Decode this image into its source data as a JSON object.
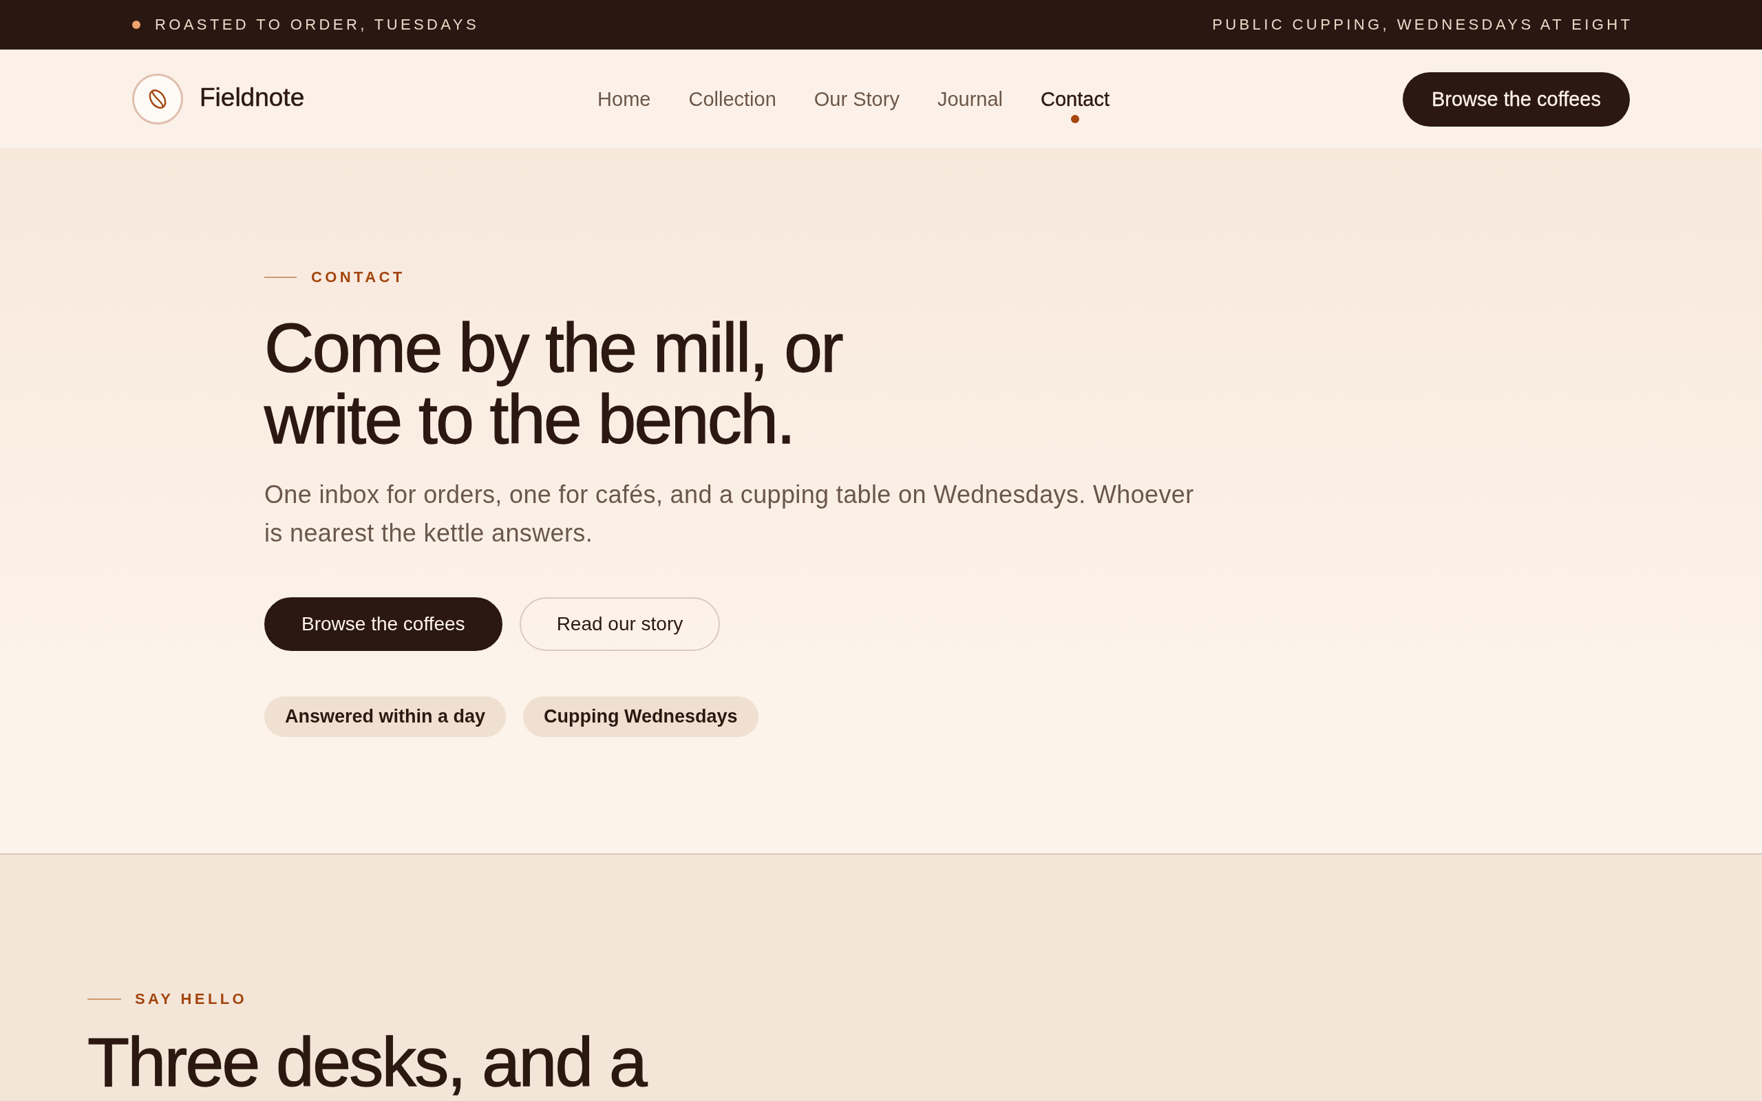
{
  "announcement_bar": {
    "left_text": "ROASTED TO ORDER, TUESDAYS",
    "right_text": "PUBLIC CUPPING, WEDNESDAYS AT EIGHT"
  },
  "header": {
    "brand": "Fieldnote",
    "nav": [
      {
        "label": "Home",
        "selected": false
      },
      {
        "label": "Collection",
        "selected": false
      },
      {
        "label": "Our Story",
        "selected": false
      },
      {
        "label": "Journal",
        "selected": false
      },
      {
        "label": "Contact",
        "selected": true
      }
    ],
    "cta_button": "Browse the coffees"
  },
  "hero": {
    "eyebrow": "CONTACT",
    "title": "Come by the mill, or write to the bench.",
    "lead": "One inbox for orders, one for cafés, and a cupping table on Wednesdays. Whoever is nearest the kettle answers.",
    "buttons": [
      {
        "label": "Browse the coffees",
        "kind": "primary"
      },
      {
        "label": "Read our story",
        "kind": "outline"
      }
    ],
    "tags": [
      "Answered within a day",
      "Cupping Wednesdays"
    ]
  },
  "say_hello": {
    "eyebrow": "SAY HELLO",
    "title": "Three desks, and a"
  }
}
